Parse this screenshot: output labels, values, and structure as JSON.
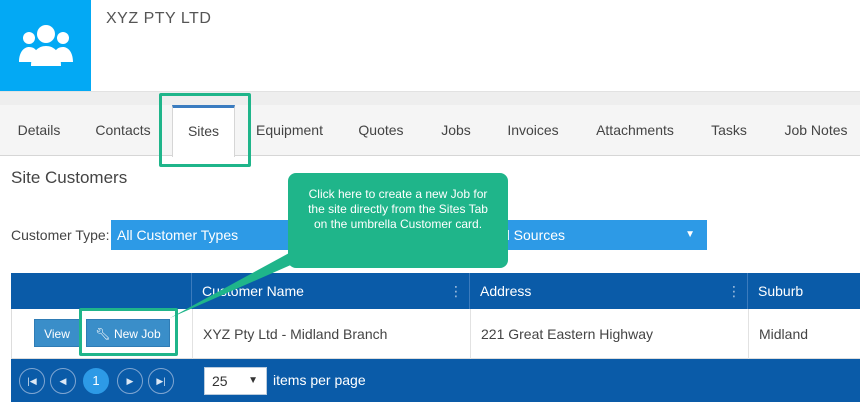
{
  "header": {
    "company": "XYZ PTY LTD",
    "avatar_icon": "users-group-icon"
  },
  "tabs": [
    {
      "label": "Details"
    },
    {
      "label": "Contacts"
    },
    {
      "label": "Sites"
    },
    {
      "label": "Equipment"
    },
    {
      "label": "Quotes"
    },
    {
      "label": "Jobs"
    },
    {
      "label": "Invoices"
    },
    {
      "label": "Attachments"
    },
    {
      "label": "Tasks"
    },
    {
      "label": "Job Notes"
    }
  ],
  "active_tab": "Sites",
  "section": {
    "title": "Site Customers"
  },
  "filters": {
    "customer_type_label": "Customer Type:",
    "customer_type_value": "All Customer Types",
    "lead_source_value": "d Sources"
  },
  "callout": {
    "text": "Click here to create a new Job for the site directly from the Sites Tab on the umbrella Customer card."
  },
  "grid": {
    "columns": [
      "Customer Name",
      "Address",
      "Suburb"
    ],
    "rows": [
      {
        "view_label": "View",
        "new_job_label": "New Job",
        "customer_name": "XYZ Pty Ltd - Midland Branch",
        "address": "221 Great Eastern Highway",
        "suburb": "Midland"
      }
    ]
  },
  "pager": {
    "current_page": "1",
    "page_size": "25",
    "items_per_page_label": "items per page"
  },
  "colors": {
    "brand": "#03a9f4",
    "header_blue": "#0a5ba8",
    "accent": "#1fb58a",
    "button": "#3a8ec9"
  }
}
